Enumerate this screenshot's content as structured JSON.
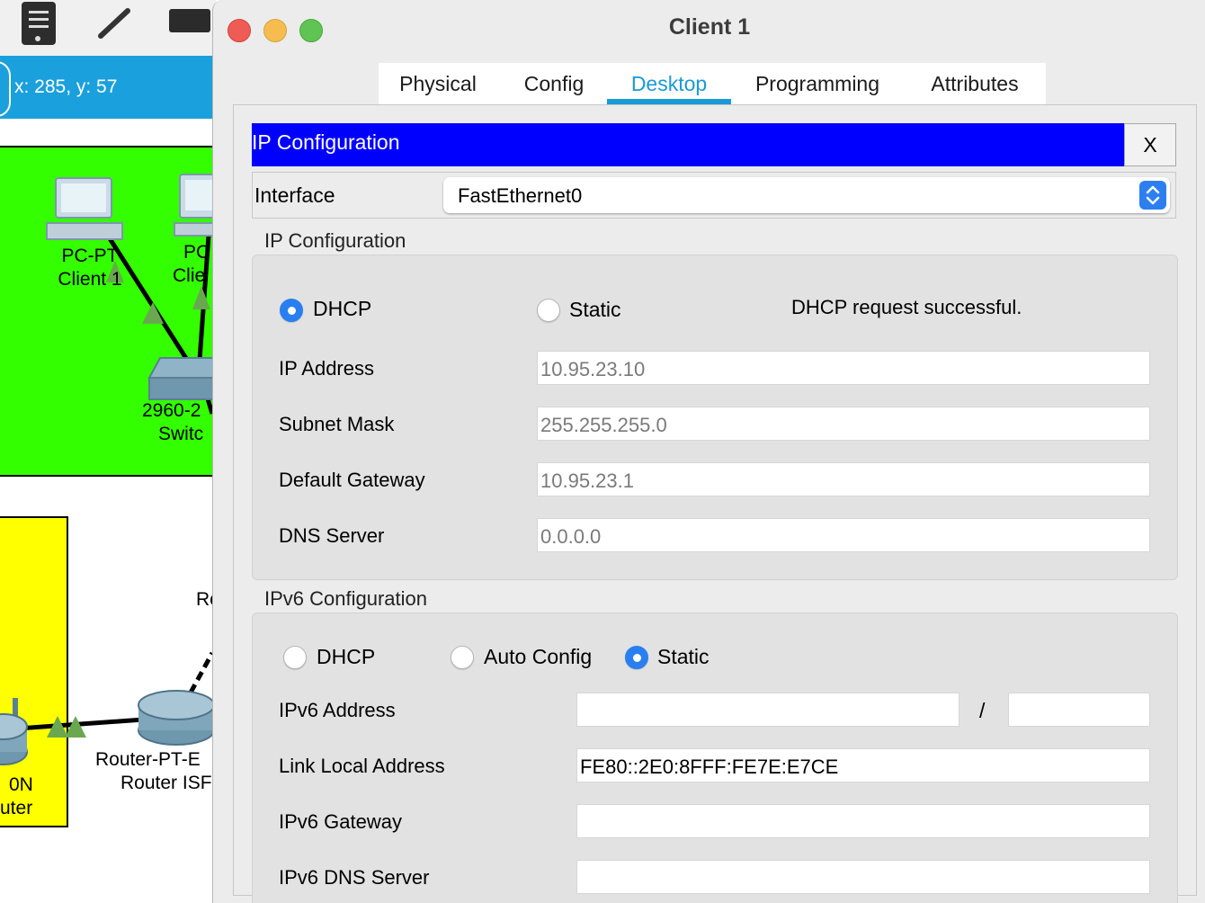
{
  "workspace": {
    "coordinates": "x: 285, y: 57",
    "nodes": {
      "pc1_line1": "PC-PT",
      "pc1_line2": "Client 1",
      "pc2_line1": "PC",
      "pc2_line2": "Clie",
      "switch_line1": "2960-2",
      "switch_line2": "Switc",
      "router_partial": "Ro",
      "router_isp_line1": "Router-PT-E",
      "router_isp_line2": "Router ISF",
      "left_router_line1": "0N",
      "left_router_line2": "uter"
    },
    "colors": {
      "toolbar_bar": "#1aa0dc",
      "green_zone": "#33ff00",
      "yellow_zone": "#ffff00"
    }
  },
  "window": {
    "title": "Client 1",
    "tabs": [
      {
        "label": "Physical",
        "active": false
      },
      {
        "label": "Config",
        "active": false
      },
      {
        "label": "Desktop",
        "active": true
      },
      {
        "label": "Programming",
        "active": false
      },
      {
        "label": "Attributes",
        "active": false
      }
    ]
  },
  "ip_config": {
    "header_title": "IP Configuration",
    "close_label": "X",
    "interface_label": "Interface",
    "interface_value": "FastEthernet0",
    "ipv4": {
      "section_title": "IP Configuration",
      "dhcp_label": "DHCP",
      "static_label": "Static",
      "mode": "DHCP",
      "status": "DHCP request successful.",
      "ip_address_label": "IP Address",
      "ip_address": "10.95.23.10",
      "subnet_mask_label": "Subnet Mask",
      "subnet_mask": "255.255.255.0",
      "default_gateway_label": "Default Gateway",
      "default_gateway": "10.95.23.1",
      "dns_server_label": "DNS Server",
      "dns_server": "0.0.0.0"
    },
    "ipv6": {
      "section_title": "IPv6 Configuration",
      "dhcp_label": "DHCP",
      "auto_config_label": "Auto Config",
      "static_label": "Static",
      "mode": "Static",
      "ipv6_address_label": "IPv6 Address",
      "ipv6_address": "",
      "prefix_separator": "/",
      "prefix_length": "",
      "link_local_label": "Link Local Address",
      "link_local_address": "FE80::2E0:8FFF:FE7E:E7CE",
      "ipv6_gateway_label": "IPv6 Gateway",
      "ipv6_gateway": "",
      "ipv6_dns_label": "IPv6 DNS Server",
      "ipv6_dns": ""
    }
  },
  "colors": {
    "accent": "#1a9ad6",
    "header_blue": "#0000ff",
    "radio_selected": "#2a7ff0"
  }
}
